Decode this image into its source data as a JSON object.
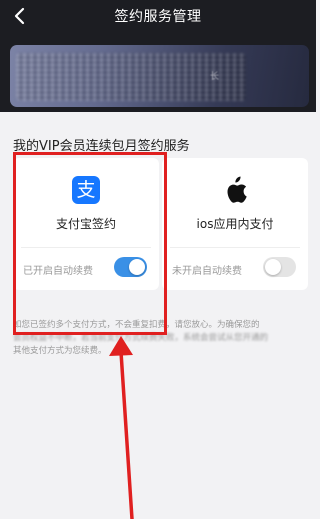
{
  "nav": {
    "title": "签约服务管理",
    "back_icon": "chevron-left-icon"
  },
  "banner": {
    "blurred_text": "长"
  },
  "section": {
    "title": "我的VIP会员连续包月签约服务"
  },
  "cards": {
    "alipay": {
      "icon_char": "支",
      "name": "支付宝签约",
      "status": "已开启自动续费",
      "toggle_state": "on"
    },
    "ios": {
      "icon": "apple-icon",
      "name": "ios应用内支付",
      "status": "未开启自动续费",
      "toggle_state": "off"
    }
  },
  "notice": {
    "line1_prefix": "如您已签约多个支付方式，不会重复扣费，请您放心。为确保您的",
    "line2_blurred": "会员权益不中断，若当前支付方式续费失败，系统会尝试从您开通的",
    "line3": "其他支付方式为您续费。"
  },
  "colors": {
    "annotation": "#e02020",
    "toggle_on": "#3a90e6",
    "header_bg": "#1c1d22"
  }
}
